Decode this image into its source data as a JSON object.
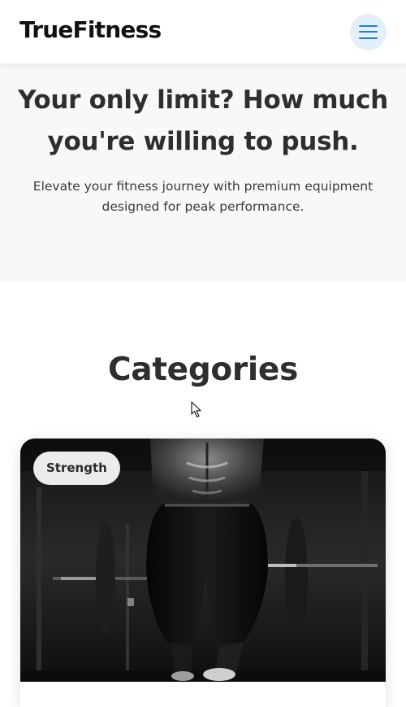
{
  "header": {
    "brand": "TrueFitness",
    "menu_icon": "hamburger-menu-icon"
  },
  "hero": {
    "title": "Your only limit? How much you're willing to push.",
    "subtitle": "Elevate your fitness journey with premium equipment designed for peak performance."
  },
  "categories": {
    "heading": "Categories",
    "items": [
      {
        "badge": "Strength"
      }
    ]
  },
  "colors": {
    "accent": "#1f7fe0",
    "menu_button_bg": "#e3f0fc",
    "hero_bg": "#f7f8fa",
    "heading_text": "#2e2e2e"
  }
}
